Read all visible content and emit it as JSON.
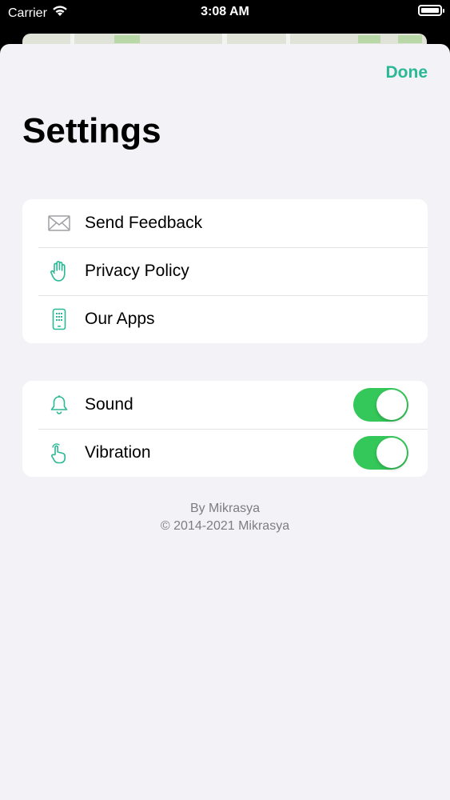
{
  "status_bar": {
    "carrier": "Carrier",
    "time": "3:08 AM"
  },
  "header": {
    "done_label": "Done",
    "title": "Settings"
  },
  "groups": [
    {
      "rows": [
        {
          "label": "Send Feedback",
          "icon": "envelope-icon"
        },
        {
          "label": "Privacy Policy",
          "icon": "hand-icon"
        },
        {
          "label": "Our Apps",
          "icon": "phone-icon"
        }
      ]
    },
    {
      "rows": [
        {
          "label": "Sound",
          "icon": "bell-icon",
          "toggle": true
        },
        {
          "label": "Vibration",
          "icon": "touch-hand-icon",
          "toggle": true
        }
      ]
    }
  ],
  "footer": {
    "line1": "By Mikrasya",
    "line2": "© 2014-2021 Mikrasya"
  },
  "colors": {
    "accent": "#2ab895",
    "toggle_on": "#34c759",
    "background": "#f2f2f7"
  }
}
